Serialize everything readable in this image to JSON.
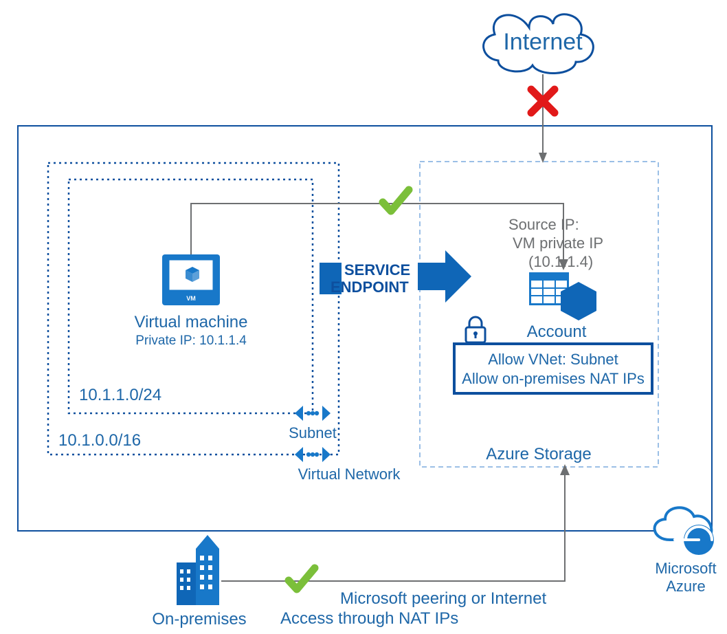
{
  "internet": "Internet",
  "service_endpoint_l1": "SERVICE",
  "service_endpoint_l2": "ENDPOINT",
  "vm": {
    "title": "Virtual machine",
    "subtitle": "Private IP: 10.1.1.4"
  },
  "subnet_cidr": "10.1.1.0/24",
  "vnet_cidr": "10.1.0.0/16",
  "subnet_label": "Subnet",
  "vnet_label": "Virtual Network",
  "storage": {
    "account": "Account",
    "rule1": "Allow VNet: Subnet",
    "rule2": "Allow on-premises NAT IPs",
    "title": "Azure Storage"
  },
  "source_ip_l1": "Source IP:",
  "source_ip_l2": "VM private IP",
  "source_ip_l3": "(10.1.1.4)",
  "onprem": "On-premises",
  "peering": "Microsoft peering or Internet",
  "nat": "Access through NAT IPs",
  "azure_l1": "Microsoft",
  "azure_l2": "Azure"
}
